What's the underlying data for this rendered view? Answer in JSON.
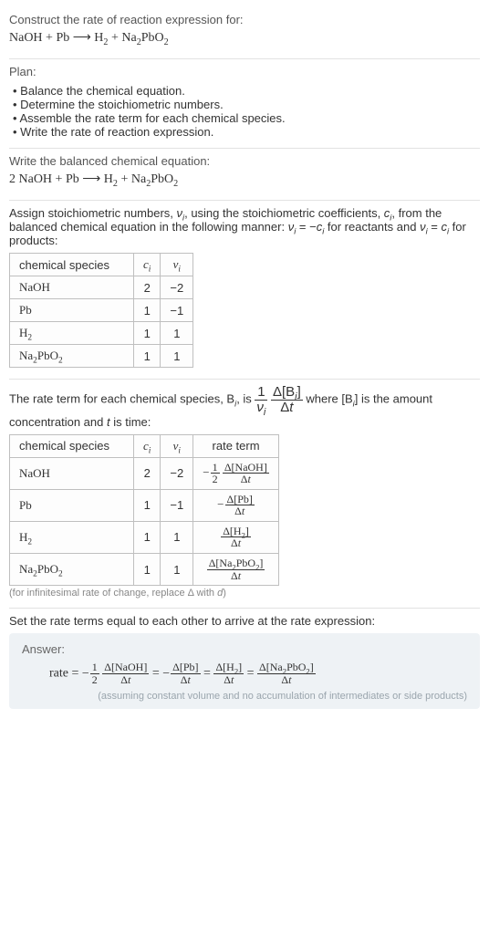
{
  "intro": {
    "heading": "Construct the rate of reaction expression for:",
    "equation_html": "NaOH + Pb ⟶ H<sub>2</sub> + Na<sub>2</sub>PbO<sub>2</sub>"
  },
  "plan": {
    "heading": "Plan:",
    "items": [
      "Balance the chemical equation.",
      "Determine the stoichiometric numbers.",
      "Assemble the rate term for each chemical species.",
      "Write the rate of reaction expression."
    ]
  },
  "balanced": {
    "heading": "Write the balanced chemical equation:",
    "equation_html": "2 NaOH + Pb ⟶ H<sub>2</sub> + Na<sub>2</sub>PbO<sub>2</sub>"
  },
  "stoich": {
    "text_html": "Assign stoichiometric numbers, <i>ν<sub>i</sub></i>, using the stoichiometric coefficients, <i>c<sub>i</sub></i>, from the balanced chemical equation in the following manner: <i>ν<sub>i</sub></i> = −<i>c<sub>i</sub></i> for reactants and <i>ν<sub>i</sub></i> = <i>c<sub>i</sub></i> for products:",
    "headers": [
      "chemical species",
      "c_i",
      "ν_i"
    ],
    "headers_html": [
      "chemical species",
      "<i>c<sub>i</sub></i>",
      "<i>ν<sub>i</sub></i>"
    ],
    "rows": [
      {
        "species_html": "NaOH",
        "c": "2",
        "v": "−2"
      },
      {
        "species_html": "Pb",
        "c": "1",
        "v": "−1"
      },
      {
        "species_html": "H<sub>2</sub>",
        "c": "1",
        "v": "1"
      },
      {
        "species_html": "Na<sub>2</sub>PbO<sub>2</sub>",
        "c": "1",
        "v": "1"
      }
    ]
  },
  "rateterms": {
    "lead_html": "The rate term for each chemical species, B<sub><i>i</i></sub>, is <span class='frac fbig inlinemid'><span class='num'>1</span><span class='den'><i>ν<sub>i</sub></i></span></span> <span class='frac fbig inlinemid'><span class='num'>Δ[B<sub><i>i</i></sub>]</span><span class='den'>Δ<i>t</i></span></span> where [B<sub><i>i</i></sub>] is the amount concentration and <i>t</i> is time:",
    "headers_html": [
      "chemical species",
      "<i>c<sub>i</sub></i>",
      "<i>ν<sub>i</sub></i>",
      "rate term"
    ],
    "rows": [
      {
        "species_html": "NaOH",
        "c": "2",
        "v": "−2",
        "rate_html": "<span class='neg'>−</span><span class='frac'><span class='num'>1</span><span class='den'>2</span></span> <span class='frac'><span class='num'>Δ[NaOH]</span><span class='den'>Δ<i>t</i></span></span>"
      },
      {
        "species_html": "Pb",
        "c": "1",
        "v": "−1",
        "rate_html": "<span class='neg'>−</span><span class='frac'><span class='num'>Δ[Pb]</span><span class='den'>Δ<i>t</i></span></span>"
      },
      {
        "species_html": "H<sub>2</sub>",
        "c": "1",
        "v": "1",
        "rate_html": "<span class='frac'><span class='num'>Δ[H<sub>2</sub>]</span><span class='den'>Δ<i>t</i></span></span>"
      },
      {
        "species_html": "Na<sub>2</sub>PbO<sub>2</sub>",
        "c": "1",
        "v": "1",
        "rate_html": "<span class='frac'><span class='num'>Δ[Na<sub>2</sub>PbO<sub>2</sub>]</span><span class='den'>Δ<i>t</i></span></span>"
      }
    ],
    "footnote_html": "(for infinitesimal rate of change, replace Δ with <i>d</i>)"
  },
  "final": {
    "lead": "Set the rate terms equal to each other to arrive at the rate expression:",
    "answer_label": "Answer:",
    "expr_html": "rate = <span class='neg'>−</span><span class='frac'><span class='num'>1</span><span class='den'>2</span></span> <span class='frac'><span class='num'>Δ[NaOH]</span><span class='den'>Δ<i>t</i></span></span> = <span class='neg'>−</span><span class='frac'><span class='num'>Δ[Pb]</span><span class='den'>Δ<i>t</i></span></span> = <span class='frac'><span class='num'>Δ[H<sub>2</sub>]</span><span class='den'>Δ<i>t</i></span></span> = <span class='frac'><span class='num'>Δ[Na<sub>2</sub>PbO<sub>2</sub>]</span><span class='den'>Δ<i>t</i></span></span>",
    "foot": "(assuming constant volume and no accumulation of intermediates or side products)"
  }
}
